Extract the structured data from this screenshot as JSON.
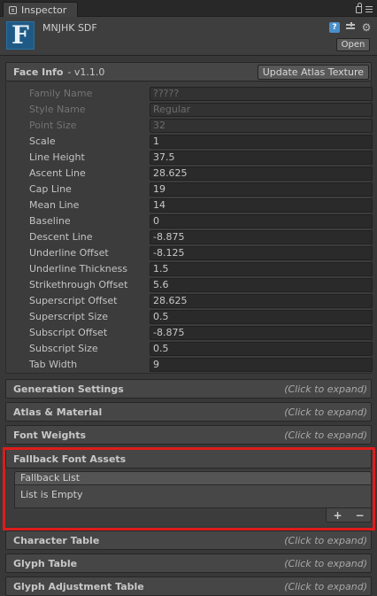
{
  "tab": {
    "label": "Inspector"
  },
  "header": {
    "asset_letter": "F",
    "asset_name": "MNJHK SDF",
    "open_label": "Open",
    "help_icon": "?"
  },
  "face_info": {
    "title": "Face Info",
    "version": "- v1.1.0",
    "update_button": "Update Atlas Texture",
    "fields": [
      {
        "label": "Family Name",
        "value": "?????",
        "disabled": true
      },
      {
        "label": "Style Name",
        "value": "Regular",
        "disabled": true
      },
      {
        "label": "Point Size",
        "value": "32",
        "disabled": true
      },
      {
        "label": "Scale",
        "value": "1",
        "disabled": false
      },
      {
        "label": "Line Height",
        "value": "37.5",
        "disabled": false
      },
      {
        "label": "Ascent Line",
        "value": "28.625",
        "disabled": false
      },
      {
        "label": "Cap Line",
        "value": "19",
        "disabled": false
      },
      {
        "label": "Mean Line",
        "value": "14",
        "disabled": false
      },
      {
        "label": "Baseline",
        "value": "0",
        "disabled": false
      },
      {
        "label": "Descent Line",
        "value": "-8.875",
        "disabled": false
      },
      {
        "label": "Underline Offset",
        "value": "-8.125",
        "disabled": false
      },
      {
        "label": "Underline Thickness",
        "value": "1.5",
        "disabled": false
      },
      {
        "label": "Strikethrough Offset",
        "value": "5.6",
        "disabled": false
      },
      {
        "label": "Superscript Offset",
        "value": "28.625",
        "disabled": false
      },
      {
        "label": "Superscript Size",
        "value": "0.5",
        "disabled": false
      },
      {
        "label": "Subscript Offset",
        "value": "-8.875",
        "disabled": false
      },
      {
        "label": "Subscript Size",
        "value": "0.5",
        "disabled": false
      },
      {
        "label": "Tab Width",
        "value": "9",
        "disabled": false
      }
    ]
  },
  "expand_hint": "(Click to expand)",
  "sections_top": [
    {
      "title": "Generation Settings"
    },
    {
      "title": "Atlas & Material"
    },
    {
      "title": "Font Weights"
    }
  ],
  "fallback": {
    "title": "Fallback Font Assets",
    "list_header": "Fallback List",
    "empty_text": "List is Empty",
    "add": "+",
    "remove": "−"
  },
  "sections_bottom": [
    {
      "title": "Character Table"
    },
    {
      "title": "Glyph Table"
    },
    {
      "title": "Glyph Adjustment Table"
    }
  ]
}
